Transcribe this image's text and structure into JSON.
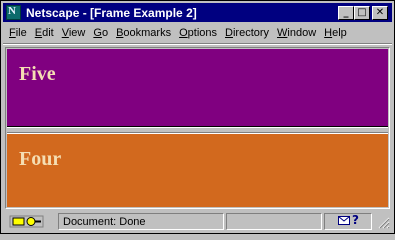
{
  "window": {
    "title": "Netscape - [Frame Example 2]",
    "app_icon_letter": "N",
    "controls": {
      "minimize": "_",
      "maximize": "□",
      "close": "✕"
    }
  },
  "menu": {
    "items": [
      {
        "mnemonic": "F",
        "rest": "ile"
      },
      {
        "mnemonic": "E",
        "rest": "dit"
      },
      {
        "mnemonic": "V",
        "rest": "iew"
      },
      {
        "mnemonic": "G",
        "rest": "o"
      },
      {
        "mnemonic": "B",
        "rest": "ookmarks"
      },
      {
        "mnemonic": "O",
        "rest": "ptions"
      },
      {
        "mnemonic": "D",
        "rest": "irectory"
      },
      {
        "mnemonic": "W",
        "rest": "indow"
      },
      {
        "mnemonic": "H",
        "rest": "elp"
      }
    ]
  },
  "frames": {
    "top": {
      "heading": "Five",
      "background": "#800080"
    },
    "bottom": {
      "heading": "Four",
      "background": "#d2691e"
    },
    "heading_color": "#f5deb3"
  },
  "status": {
    "text": "Document: Done",
    "icons": [
      "security-key-icon",
      "mail-icon",
      "help-icon"
    ]
  }
}
